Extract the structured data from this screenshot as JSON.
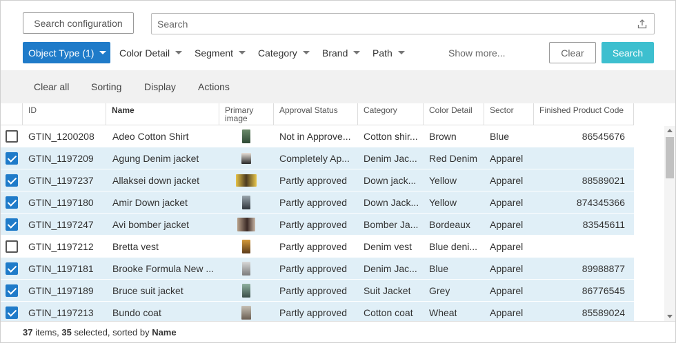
{
  "top": {
    "search_config_label": "Search configuration",
    "search_placeholder": "Search"
  },
  "filters": {
    "object_type": "Object Type (1)",
    "color_detail": "Color Detail",
    "segment": "Segment",
    "category": "Category",
    "brand": "Brand",
    "path": "Path",
    "show_more": "Show more...",
    "clear": "Clear",
    "search": "Search"
  },
  "toolbar": {
    "clear_all": "Clear all",
    "sorting": "Sorting",
    "display": "Display",
    "actions": "Actions"
  },
  "table": {
    "headers": {
      "id": "ID",
      "name": "Name",
      "primary_image": "Primary image",
      "approval_status": "Approval Status",
      "category": "Category",
      "color_detail": "Color Detail",
      "sector": "Sector",
      "finished_product_code": "Finished Product Code"
    },
    "rows": [
      {
        "selected": false,
        "id": "GTIN_1200208",
        "name": "Adeo Cotton Shirt",
        "image": "shirt-photo",
        "approval": "Not in Approve...",
        "category": "Cotton shir...",
        "color": "Brown",
        "sector": "Blue",
        "code": "86545676"
      },
      {
        "selected": true,
        "id": "GTIN_1197209",
        "name": "Agung Denim jacket",
        "image": "jacket-photo",
        "approval": "Completely Ap...",
        "category": "Denim Jac...",
        "color": "Red Denim",
        "sector": "Apparel",
        "code": ""
      },
      {
        "selected": true,
        "id": "GTIN_1197237",
        "name": "Allaksei down jacket",
        "image": "down-jacket-photo",
        "approval": "Partly approved",
        "category": "Down jack...",
        "color": "Yellow",
        "sector": "Apparel",
        "code": "88589021"
      },
      {
        "selected": true,
        "id": "GTIN_1197180",
        "name": "Amir Down jacket",
        "image": "down-jacket-photo",
        "approval": "Partly approved",
        "category": "Down Jack...",
        "color": "Yellow",
        "sector": "Apparel",
        "code": "874345366"
      },
      {
        "selected": true,
        "id": "GTIN_1197247",
        "name": "Avi bomber jacket",
        "image": "bomber-photo",
        "approval": "Partly approved",
        "category": "Bomber Ja...",
        "color": "Bordeaux",
        "sector": "Apparel",
        "code": "83545611"
      },
      {
        "selected": false,
        "id": "GTIN_1197212",
        "name": "Bretta vest",
        "image": "vest-photo",
        "approval": "Partly approved",
        "category": "Denim vest",
        "color": "Blue deni...",
        "sector": "Apparel",
        "code": ""
      },
      {
        "selected": true,
        "id": "GTIN_1197181",
        "name": "Brooke Formula New ...",
        "image": "formula-photo",
        "approval": "Partly approved",
        "category": "Denim Jac...",
        "color": "Blue",
        "sector": "Apparel",
        "code": "89988877"
      },
      {
        "selected": true,
        "id": "GTIN_1197189",
        "name": "Bruce suit jacket",
        "image": "suit-photo",
        "approval": "Partly approved",
        "category": "Suit Jacket",
        "color": "Grey",
        "sector": "Apparel",
        "code": "86776545"
      },
      {
        "selected": true,
        "id": "GTIN_1197213",
        "name": "Bundo coat",
        "image": "coat-photo",
        "approval": "Partly approved",
        "category": "Cotton coat",
        "color": "Wheat",
        "sector": "Apparel",
        "code": "85589024"
      }
    ]
  },
  "footer": {
    "total": "37",
    "items_text": " items, ",
    "selected": "35",
    "selected_text": " selected, sorted by ",
    "sort_field": "Name"
  },
  "colors": {
    "primary": "#1f7bc9",
    "search_button": "#3dbfcf",
    "row_selected": "#e0eff7"
  }
}
